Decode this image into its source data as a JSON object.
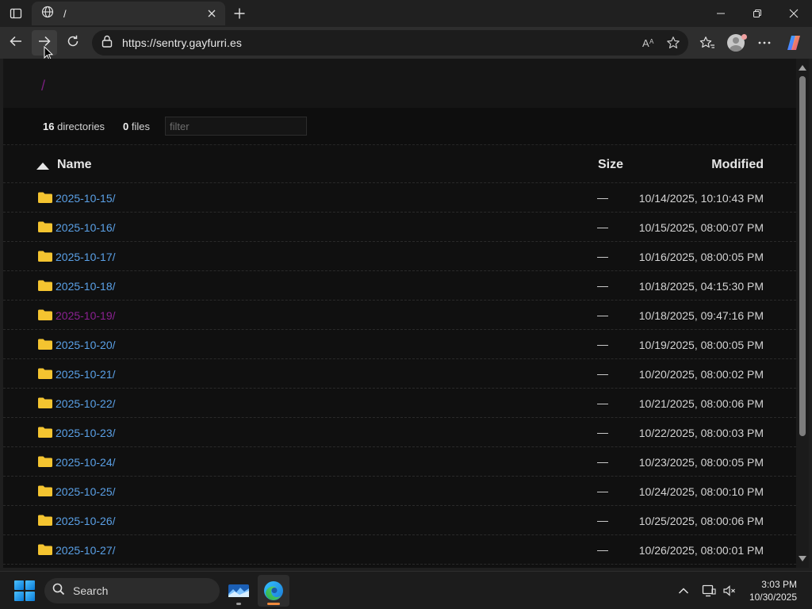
{
  "browser": {
    "tab_title": "/",
    "url": "https://sentry.gayfurri.es"
  },
  "page": {
    "breadcrumb": "/",
    "summary": {
      "directories_count": "16",
      "directories_label": "directories",
      "files_count": "0",
      "files_label": "files"
    },
    "filter_placeholder": "filter",
    "columns": {
      "name": "Name",
      "size": "Size",
      "modified": "Modified"
    },
    "rows": [
      {
        "name": "2025-10-15/",
        "size": "—",
        "modified": "10/14/2025, 10:10:43 PM",
        "visited": false
      },
      {
        "name": "2025-10-16/",
        "size": "—",
        "modified": "10/15/2025, 08:00:07 PM",
        "visited": false
      },
      {
        "name": "2025-10-17/",
        "size": "—",
        "modified": "10/16/2025, 08:00:05 PM",
        "visited": false
      },
      {
        "name": "2025-10-18/",
        "size": "—",
        "modified": "10/18/2025, 04:15:30 PM",
        "visited": false
      },
      {
        "name": "2025-10-19/",
        "size": "—",
        "modified": "10/18/2025, 09:47:16 PM",
        "visited": true
      },
      {
        "name": "2025-10-20/",
        "size": "—",
        "modified": "10/19/2025, 08:00:05 PM",
        "visited": false
      },
      {
        "name": "2025-10-21/",
        "size": "—",
        "modified": "10/20/2025, 08:00:02 PM",
        "visited": false
      },
      {
        "name": "2025-10-22/",
        "size": "—",
        "modified": "10/21/2025, 08:00:06 PM",
        "visited": false
      },
      {
        "name": "2025-10-23/",
        "size": "—",
        "modified": "10/22/2025, 08:00:03 PM",
        "visited": false
      },
      {
        "name": "2025-10-24/",
        "size": "—",
        "modified": "10/23/2025, 08:00:05 PM",
        "visited": false
      },
      {
        "name": "2025-10-25/",
        "size": "—",
        "modified": "10/24/2025, 08:00:10 PM",
        "visited": false
      },
      {
        "name": "2025-10-26/",
        "size": "—",
        "modified": "10/25/2025, 08:00:06 PM",
        "visited": false
      },
      {
        "name": "2025-10-27/",
        "size": "—",
        "modified": "10/26/2025, 08:00:01 PM",
        "visited": false
      }
    ]
  },
  "taskbar": {
    "search_label": "Search",
    "time": "3:03 PM",
    "date": "10/30/2025"
  },
  "colors": {
    "link": "#5aa0e6",
    "visited_link": "#8a2191",
    "folder": "#f4c430",
    "page_bg": "#101010"
  },
  "icons": {
    "tab_actions": "tab-actions-icon",
    "tab_favicon": "globe-icon",
    "back": "arrow-left-icon",
    "forward": "arrow-right-icon",
    "refresh": "refresh-icon",
    "site_info": "lock-icon",
    "read_aloud": "read-aloud-icon",
    "favorite": "star-icon",
    "favorites": "favorites-icon",
    "profile": "profile-avatar",
    "more": "more-icon",
    "copilot": "copilot-icon",
    "folder": "folder-icon",
    "taskbar_weather": "weather-widget-icon",
    "taskbar_edge": "edge-icon"
  }
}
